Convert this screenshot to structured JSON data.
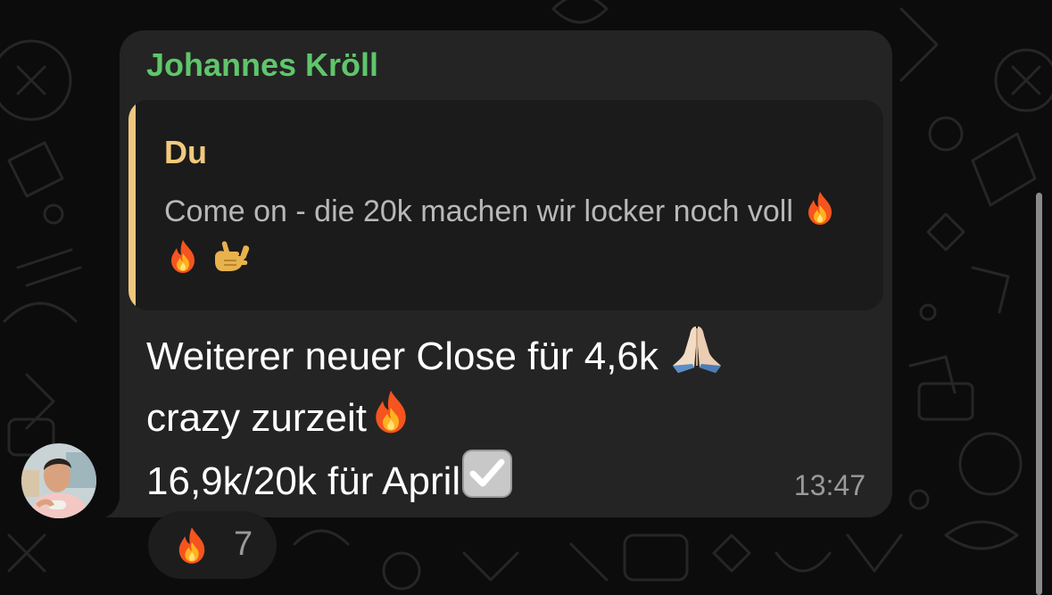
{
  "message": {
    "sender_name": "Johannes Kröll",
    "quote": {
      "author": "Du",
      "text": "Come on - die 20k machen wir locker noch voll",
      "emojis": [
        "fire-emoji",
        "fire-emoji",
        "call-me-hand-emoji"
      ]
    },
    "lines": [
      "Weiterer neuer Close für 4,6k",
      "crazy zurzeit",
      "16,9k/20k für April"
    ],
    "line_emojis": [
      "folded-hands-emoji",
      "fire-emoji",
      "check-box-emoji"
    ],
    "time": "13:47"
  },
  "reaction": {
    "emoji": "fire-emoji",
    "count": "7"
  },
  "colors": {
    "sender": "#5fc66b",
    "quote_accent": "#f0c77e",
    "bubble": "#242424",
    "background": "#0c0c0c"
  }
}
